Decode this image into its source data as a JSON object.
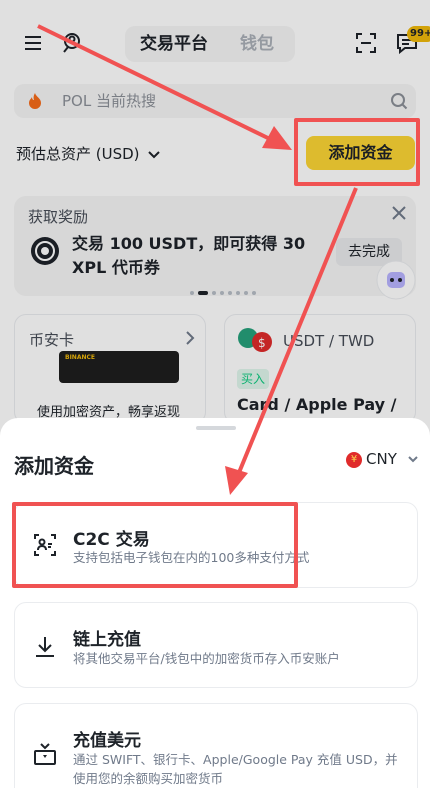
{
  "header": {
    "tabs": [
      {
        "label": "交易平台"
      },
      {
        "label": "钱包"
      }
    ],
    "notification_badge": "99+"
  },
  "search": {
    "placeholder": "POL 当前热搜"
  },
  "assets": {
    "label": "预估总资产 (USD)",
    "add_button": "添加资金"
  },
  "reward": {
    "title": "获取奖励",
    "text": "交易 100 USDT，即可获得 30 XPL 代币券",
    "action": "去完成"
  },
  "cards": {
    "binance_card": {
      "title": "币安卡",
      "card_brand": "BINANCE",
      "desc": "使用加密资产，畅享返现"
    },
    "fiat_card": {
      "pair": "USDT / TWD",
      "tag": "买入",
      "method": "Card / Apple Pay /"
    }
  },
  "sheet": {
    "title": "添加资金",
    "currency": "CNY",
    "currency_symbol": "¥",
    "options": [
      {
        "title": "C2C 交易",
        "desc": "支持包括电子钱包在内的100多种支付方式",
        "icon": "c2c-people-icon"
      },
      {
        "title": "链上充值",
        "desc": "将其他交易平台/钱包中的加密货币存入币安账户",
        "icon": "download-arrow-icon"
      },
      {
        "title": "充值美元",
        "desc": "通过 SWIFT、银行卡、Apple/Google Pay 充值 USD，并使用您的余额购买加密货币",
        "icon": "bank-deposit-icon"
      }
    ]
  },
  "colors": {
    "accent": "#fcd535",
    "annotation": "#f05252",
    "buy_green": "#0ecb81"
  }
}
